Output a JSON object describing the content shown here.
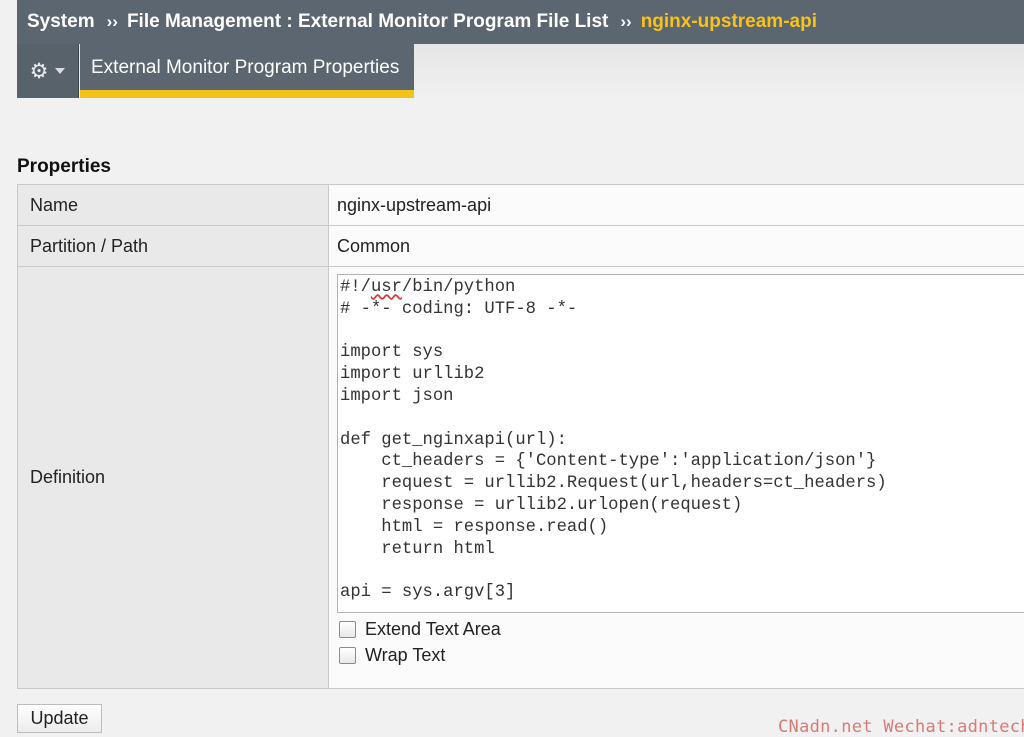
{
  "breadcrumb": {
    "item1": "System",
    "sep1": "››",
    "item2": "File Management : External Monitor Program File List",
    "sep2": "››",
    "current": "nginx-upstream-api"
  },
  "toolbar": {
    "gear_icon": "gear-icon",
    "active_tab": "External Monitor Program Properties",
    "accent_color": "#f3c216"
  },
  "properties": {
    "title": "Properties",
    "rows": [
      {
        "label": "Name",
        "value": "nginx-upstream-api"
      },
      {
        "label": "Partition / Path",
        "value": "Common"
      },
      {
        "label": "Definition"
      }
    ],
    "definition_lines": [
      "#!/usr/bin/python",
      "# -*- coding: UTF-8 -*-",
      "",
      "import sys",
      "import urllib2",
      "import json",
      "",
      "def get_nginxapi(url):",
      "    ct_headers = {'Content-type':'application/json'}",
      "    request = urllib2.Request(url,headers=ct_headers)",
      "    response = urllib2.urlopen(request)",
      "    html = response.read()",
      "    return html",
      "",
      "api = sys.argv[3]"
    ],
    "extend_text_area_label": "Extend Text Area",
    "wrap_text_label": "Wrap Text"
  },
  "actions": {
    "update_label": "Update"
  },
  "watermark": "CNadn.net Wechat:adntech"
}
